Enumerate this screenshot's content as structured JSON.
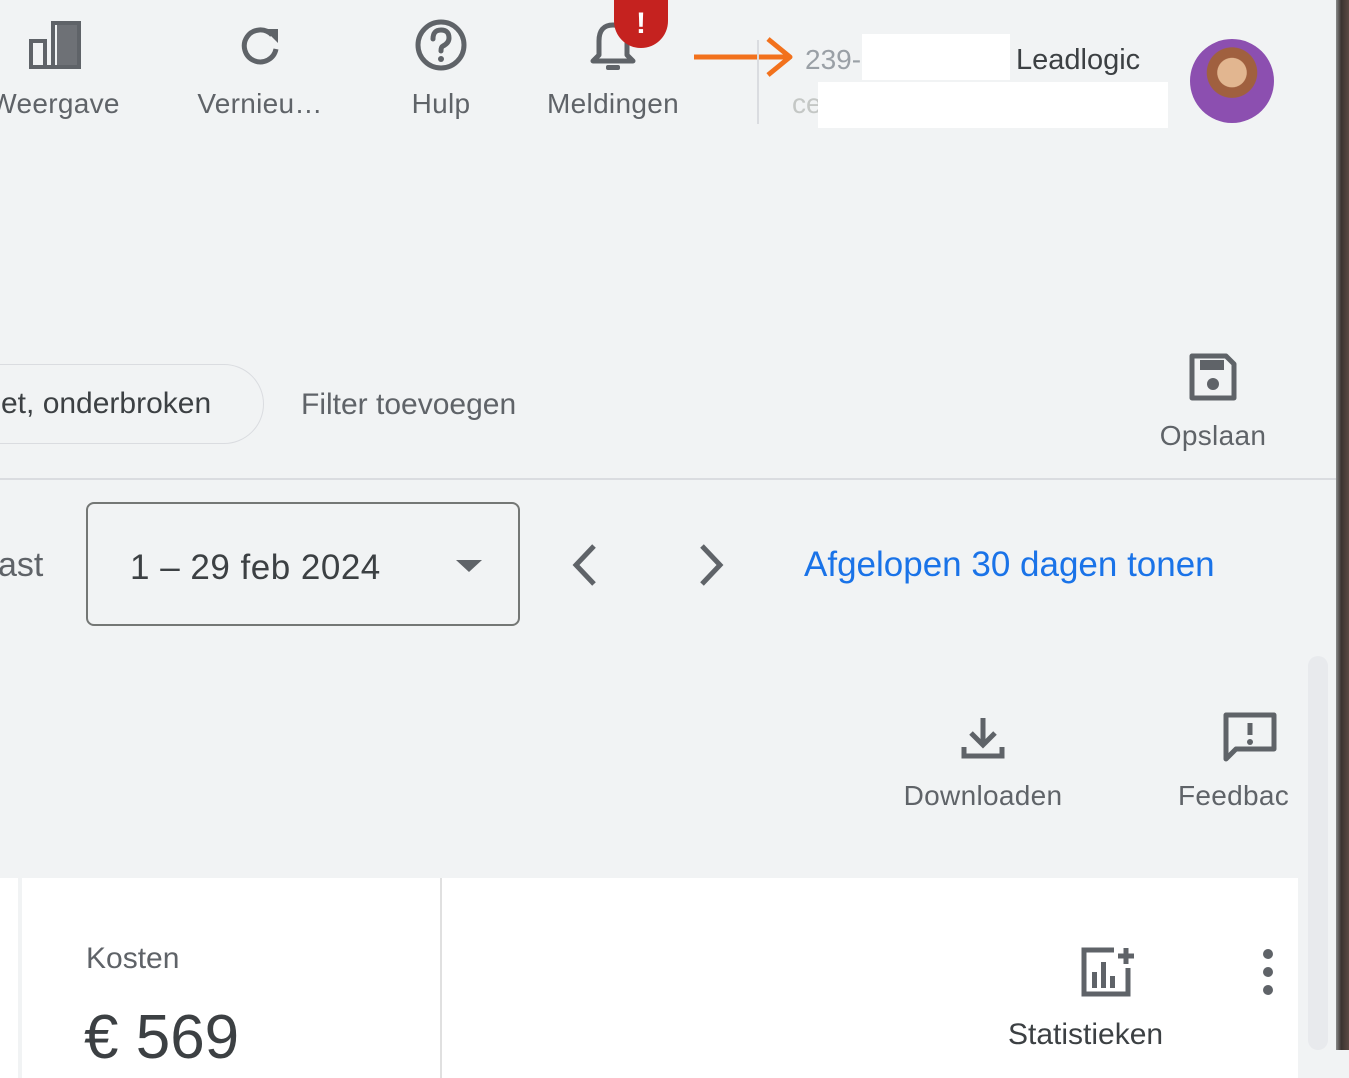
{
  "toolbar": {
    "items": [
      {
        "label": "Weergave",
        "icon": "bar-chart-icon"
      },
      {
        "label": "Vernieu…",
        "icon": "refresh-icon"
      },
      {
        "label": "Hulp",
        "icon": "help-circle-icon"
      },
      {
        "label": "Meldingen",
        "icon": "bell-icon",
        "badge": "!"
      }
    ]
  },
  "account": {
    "id": "239-2",
    "sub": "ce",
    "name": "Leadlogic"
  },
  "filters": {
    "chip_label": "et, onderbroken",
    "add_filter": "Filter toevoegen",
    "save_label": "Opslaan"
  },
  "date": {
    "prefix": "ast",
    "range": "1 – 29 feb 2024",
    "last30_link": "Afgelopen 30 dagen tonen"
  },
  "actions": {
    "download": "Downloaden",
    "feedback": "Feedbac"
  },
  "metrics": {
    "cost_label": "Kosten",
    "cost_value": "€ 569",
    "stats_label": "Statistieken"
  },
  "colors": {
    "accent_link": "#1a73e8",
    "alert_badge": "#c5221f",
    "annotation_arrow": "#f2711c",
    "background": "#f1f3f4"
  }
}
